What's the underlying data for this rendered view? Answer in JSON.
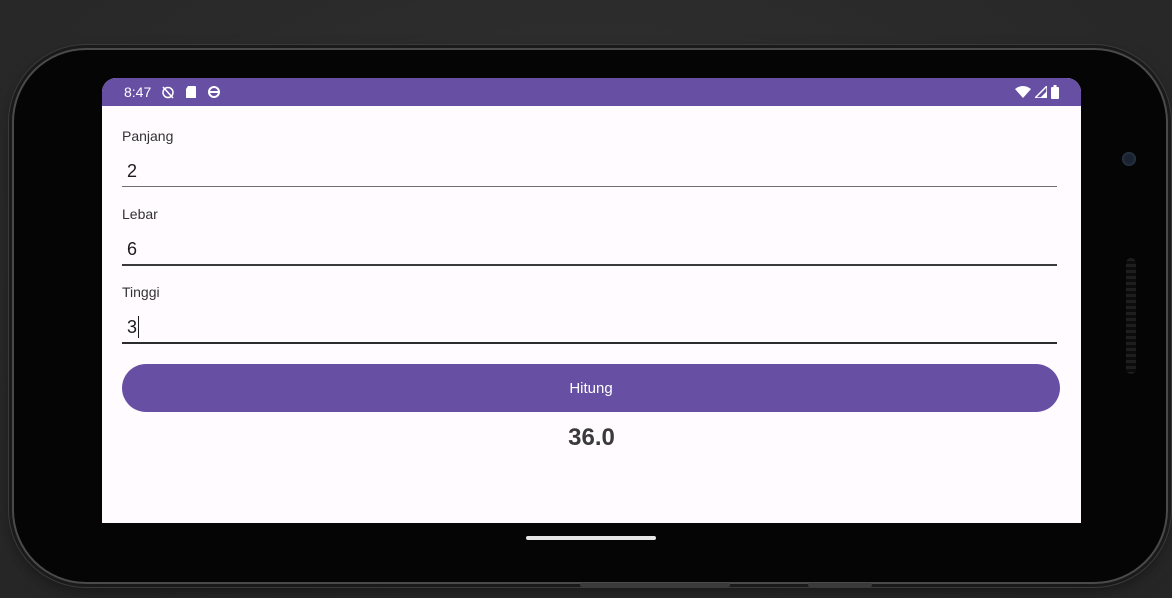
{
  "status_bar": {
    "time": "8:47",
    "left_icons": [
      "alarm-off-icon",
      "sd-card-icon",
      "sync-icon"
    ],
    "right_icons": [
      "wifi-icon",
      "cell-signal-icon",
      "battery-icon"
    ],
    "color": "#6750a4"
  },
  "form": {
    "panjang": {
      "label": "Panjang",
      "value": "2"
    },
    "lebar": {
      "label": "Lebar",
      "value": "6"
    },
    "tinggi": {
      "label": "Tinggi",
      "value": "3"
    }
  },
  "button": {
    "label": "Hitung",
    "color": "#6750a4"
  },
  "result": {
    "value": "36.0"
  },
  "colors": {
    "screen_bg": "#fffbfe",
    "accent": "#6750a4"
  }
}
